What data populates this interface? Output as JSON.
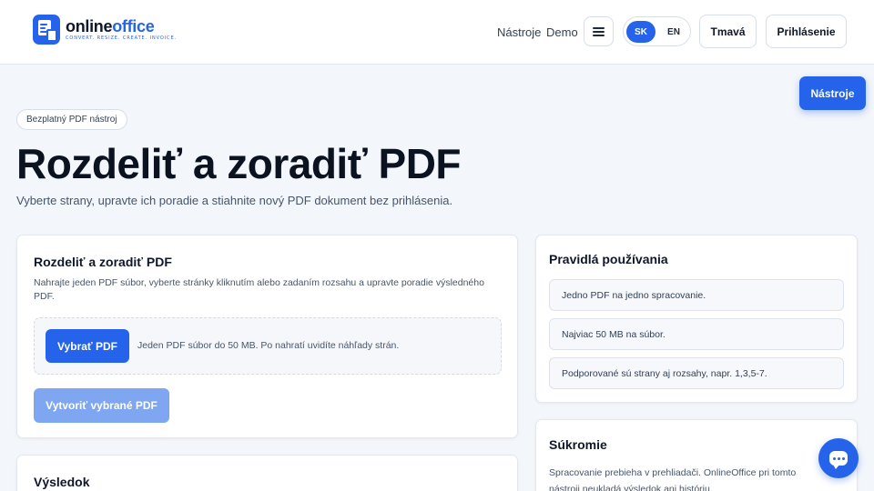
{
  "brand": {
    "name_part1": "online",
    "name_part2": "office",
    "tagline": "CONVERT. RESIZE. CREATE. INVOICE."
  },
  "header": {
    "nav": [
      "Nástroje",
      "Demo"
    ],
    "lang_active": "SK",
    "lang_other": "EN",
    "theme_label": "Tmavá",
    "login_label": "Prihlásenie"
  },
  "floating": {
    "tools_label": "Nástroje"
  },
  "hero": {
    "badge": "Bezplatný PDF nástroj",
    "title": "Rozdeliť a zoradiť PDF",
    "subtitle": "Vyberte strany, upravte ich poradie a stiahnite nový PDF dokument bez prihlásenia."
  },
  "tool_card": {
    "title": "Rozdeliť a zoradiť PDF",
    "description": "Nahrajte jeden PDF súbor, vyberte stránky kliknutím alebo zadaním rozsahu a upravte poradie výsledného PDF.",
    "pick_label": "Vybrať PDF",
    "pick_hint": "Jeden PDF súbor do 50 MB. Po nahratí uvidíte náhľady strán.",
    "create_label": "Vytvoriť vybrané PDF"
  },
  "result_card": {
    "title": "Výsledok"
  },
  "rules_card": {
    "title": "Pravidlá používania",
    "items": [
      "Jedno PDF na jedno spracovanie.",
      "Najviac 50 MB na súbor.",
      "Podporované sú strany aj rozsahy, napr. 1,3,5-7."
    ]
  },
  "privacy_card": {
    "title": "Súkromie",
    "text": "Spracovanie prebieha v prehliadači. OnlineOffice pri tomto nástroji neukladá výsledok ani históriu."
  },
  "colors": {
    "accent": "#2563eb",
    "accent_disabled": "#7ea6f1",
    "background": "#f3f6fa"
  }
}
